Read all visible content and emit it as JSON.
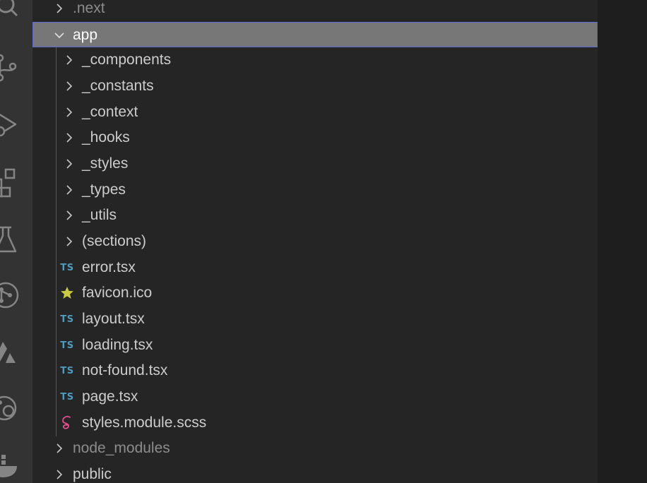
{
  "explorer": {
    "rows": [
      {
        "label": ".next",
        "kind": "folder",
        "state": "collapsed",
        "level": 0,
        "dim": true
      },
      {
        "label": "app",
        "kind": "folder",
        "state": "expanded",
        "level": 0,
        "selected": true
      },
      {
        "label": "_components",
        "kind": "folder",
        "state": "collapsed",
        "level": 1
      },
      {
        "label": "_constants",
        "kind": "folder",
        "state": "collapsed",
        "level": 1
      },
      {
        "label": "_context",
        "kind": "folder",
        "state": "collapsed",
        "level": 1
      },
      {
        "label": "_hooks",
        "kind": "folder",
        "state": "collapsed",
        "level": 1
      },
      {
        "label": "_styles",
        "kind": "folder",
        "state": "collapsed",
        "level": 1
      },
      {
        "label": "_types",
        "kind": "folder",
        "state": "collapsed",
        "level": 1
      },
      {
        "label": "_utils",
        "kind": "folder",
        "state": "collapsed",
        "level": 1
      },
      {
        "label": "(sections)",
        "kind": "folder",
        "state": "collapsed",
        "level": 1
      },
      {
        "label": "error.tsx",
        "kind": "file",
        "icon": "typescript-icon",
        "icon_text": "TS",
        "level": 1
      },
      {
        "label": "favicon.ico",
        "kind": "file",
        "icon": "star-icon",
        "level": 1
      },
      {
        "label": "layout.tsx",
        "kind": "file",
        "icon": "typescript-icon",
        "icon_text": "TS",
        "level": 1
      },
      {
        "label": "loading.tsx",
        "kind": "file",
        "icon": "typescript-icon",
        "icon_text": "TS",
        "level": 1
      },
      {
        "label": "not-found.tsx",
        "kind": "file",
        "icon": "typescript-icon",
        "icon_text": "TS",
        "level": 1
      },
      {
        "label": "page.tsx",
        "kind": "file",
        "icon": "typescript-icon",
        "icon_text": "TS",
        "level": 1
      },
      {
        "label": "styles.module.scss",
        "kind": "file",
        "icon": "sass-icon",
        "level": 1
      },
      {
        "label": "node_modules",
        "kind": "folder",
        "state": "collapsed",
        "level": 0,
        "dim": true
      },
      {
        "label": "public",
        "kind": "folder",
        "state": "collapsed",
        "level": 0
      }
    ]
  },
  "activity_bar": {
    "icons": [
      "search-icon",
      "source-control-icon",
      "run-debug-icon",
      "extensions-icon",
      "testing-icon",
      "git-graph-icon",
      "azure-icon",
      "remote-explorer-icon",
      "docker-icon"
    ]
  },
  "colors": {
    "selection_bg": "#777777",
    "selection_border": "#5a6ad8",
    "typescript": "#519aba",
    "favicon_star": "#cbcb41",
    "sass": "#e44f8f"
  }
}
